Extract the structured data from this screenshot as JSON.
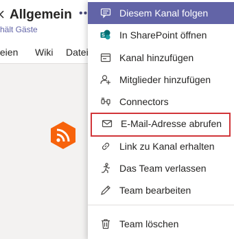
{
  "header": {
    "title": "Allgemein",
    "subtitle": "hält Gäste",
    "more": "•••"
  },
  "tabs": [
    {
      "label": "teien"
    },
    {
      "label": "Wiki"
    },
    {
      "label": "Datei"
    }
  ],
  "menu": {
    "items": [
      {
        "label": "Diesem Kanal folgen",
        "icon": "follow-channel-icon"
      },
      {
        "label": "In SharePoint öffnen",
        "icon": "sharepoint-icon"
      },
      {
        "label": "Kanal hinzufügen",
        "icon": "add-channel-icon"
      },
      {
        "label": "Mitglieder hinzufügen",
        "icon": "add-members-icon"
      },
      {
        "label": "Connectors",
        "icon": "connectors-icon"
      },
      {
        "label": "E-Mail-Adresse abrufen",
        "icon": "mail-icon"
      },
      {
        "label": "Link zu Kanal erhalten",
        "icon": "link-icon"
      },
      {
        "label": "Das Team verlassen",
        "icon": "leave-team-icon"
      },
      {
        "label": "Team bearbeiten",
        "icon": "edit-icon"
      },
      {
        "label": "Team löschen",
        "icon": "trash-icon"
      }
    ]
  },
  "colors": {
    "accent": "#6264a7",
    "highlight_border": "#d13438",
    "rss_orange": "#f7630c",
    "sharepoint_blue": "#036c70"
  }
}
